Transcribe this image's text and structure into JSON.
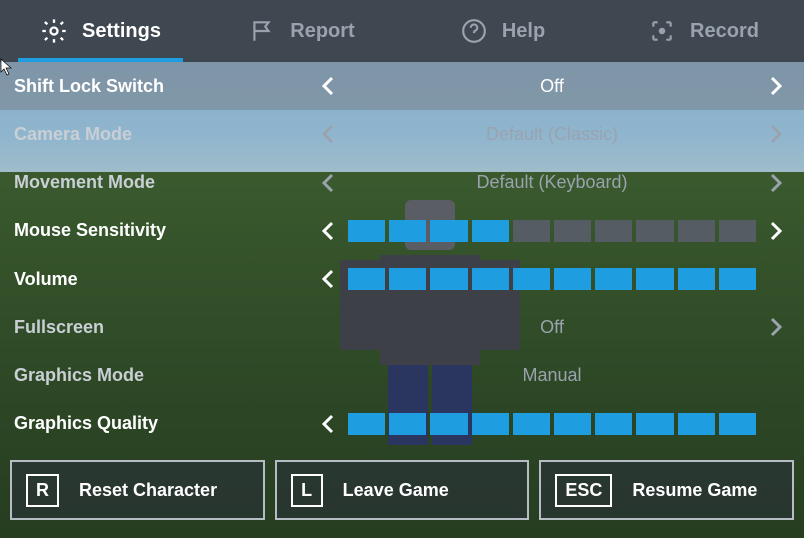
{
  "tabs": {
    "settings": "Settings",
    "report": "Report",
    "help": "Help",
    "record": "Record"
  },
  "settings": {
    "shift_lock": {
      "label": "Shift Lock Switch",
      "value": "Off"
    },
    "camera_mode": {
      "label": "Camera Mode",
      "value": "Default (Classic)"
    },
    "movement_mode": {
      "label": "Movement Mode",
      "value": "Default (Keyboard)"
    },
    "mouse_sensitivity": {
      "label": "Mouse Sensitivity",
      "level": 4,
      "max": 10
    },
    "volume": {
      "label": "Volume",
      "level": 10,
      "max": 10
    },
    "fullscreen": {
      "label": "Fullscreen",
      "value": "Off"
    },
    "graphics_mode": {
      "label": "Graphics Mode",
      "value": "Manual"
    },
    "graphics_quality": {
      "label": "Graphics Quality",
      "level": 10,
      "max": 10
    }
  },
  "buttons": {
    "reset": {
      "key": "R",
      "label": "Reset Character"
    },
    "leave": {
      "key": "L",
      "label": "Leave Game"
    },
    "resume": {
      "key": "ESC",
      "label": "Resume Game"
    }
  }
}
